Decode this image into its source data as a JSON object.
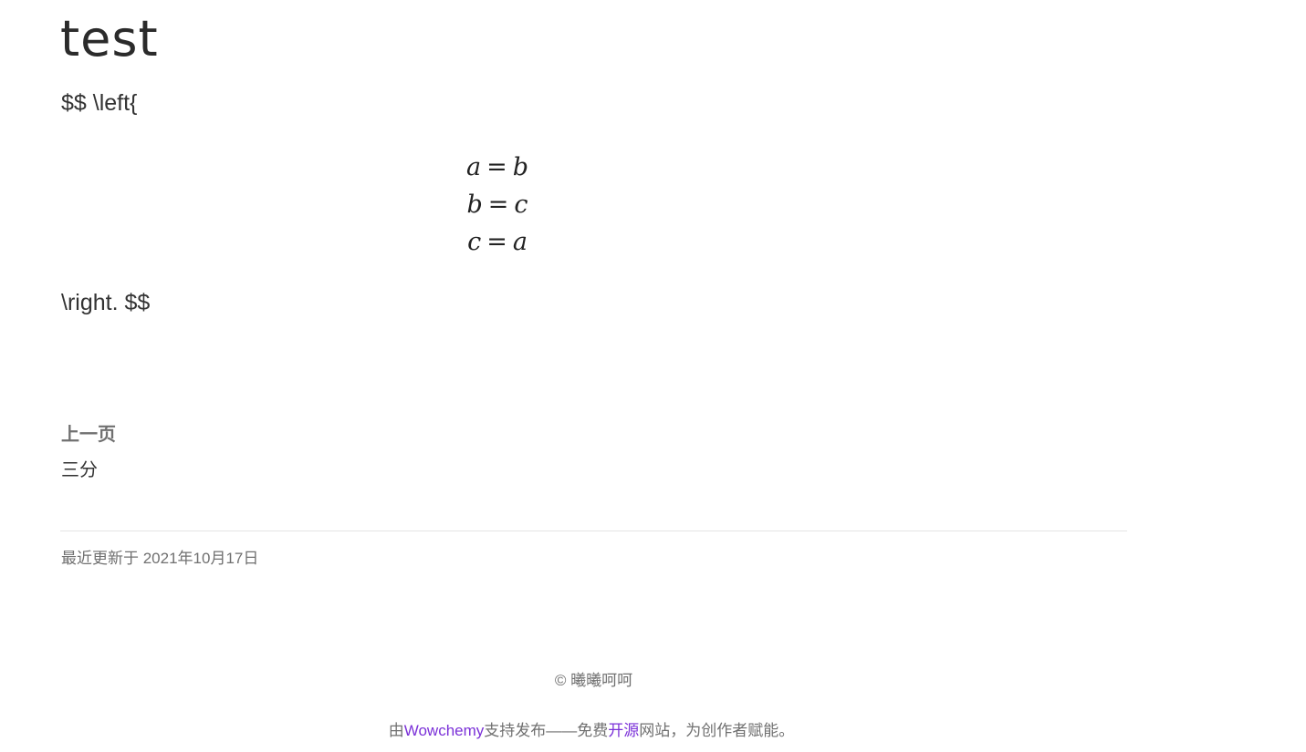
{
  "page": {
    "title": "test",
    "latex_open": "$$ \\left{",
    "latex_close": "\\right. $$",
    "equations": [
      {
        "lhs": "a",
        "op": "=",
        "rhs": "b"
      },
      {
        "lhs": "b",
        "op": "=",
        "rhs": "c"
      },
      {
        "lhs": "c",
        "op": "=",
        "rhs": "a"
      }
    ]
  },
  "pager": {
    "prev_label": "上一页",
    "prev_title": "三分"
  },
  "meta": {
    "last_updated": "最近更新于 2021年10月17日"
  },
  "footer": {
    "copyright": "© 曦曦呵呵",
    "powered_prefix": "由",
    "powered_link": "Wowchemy",
    "powered_middle": "支持发布——免费",
    "open_source_link": "开源",
    "powered_suffix": "网站，为创作者赋能。"
  },
  "colors": {
    "link": "#7b31d8",
    "muted": "#707070"
  }
}
